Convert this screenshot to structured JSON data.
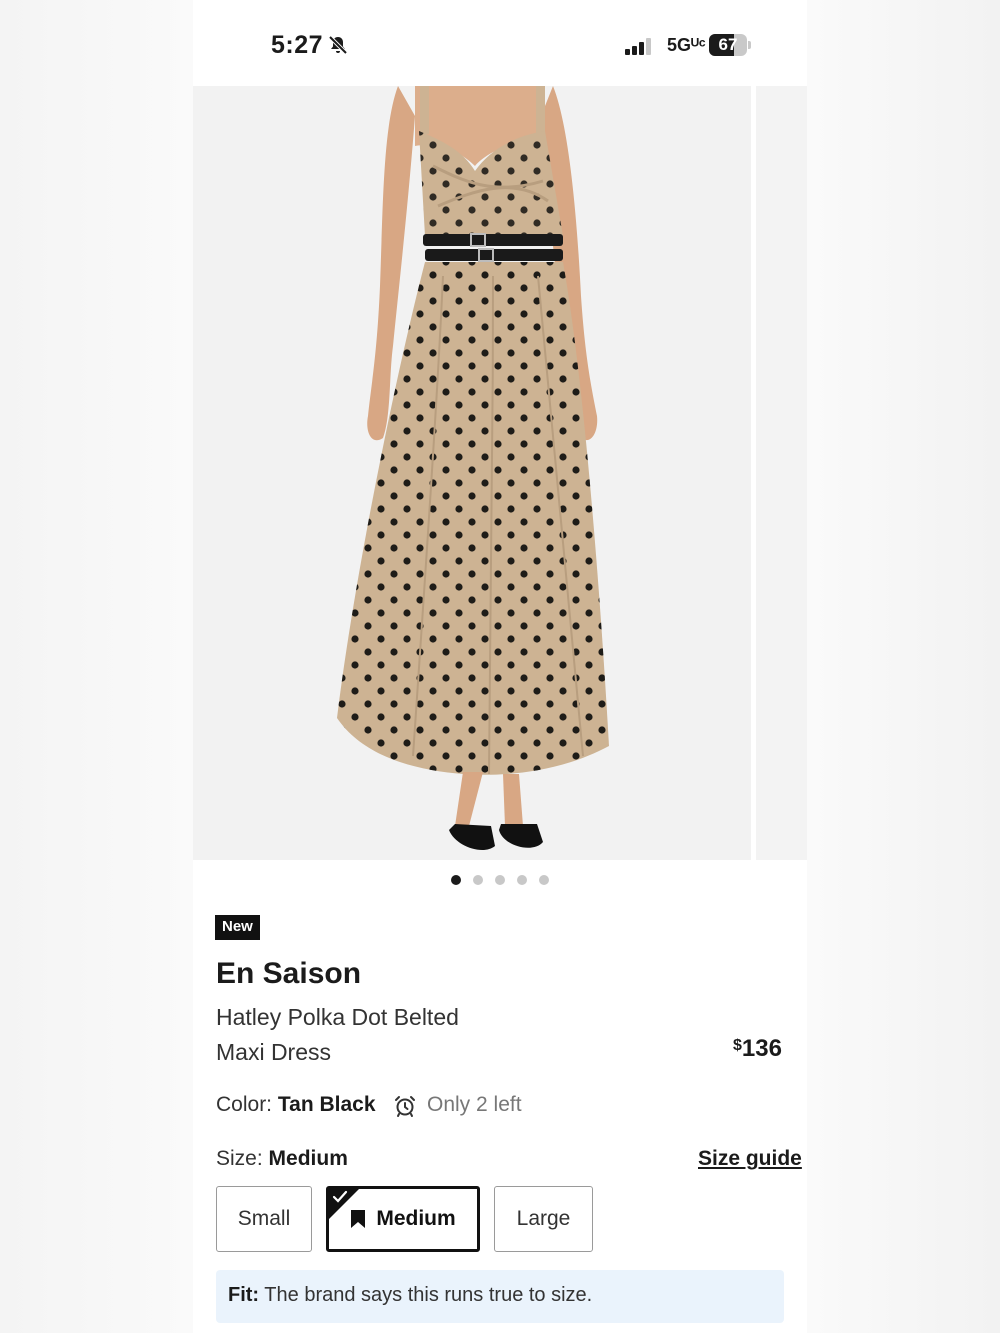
{
  "status_bar": {
    "time": "5:27",
    "network": "5Gᵁᶜ",
    "battery_level": "67",
    "battery_fraction": 0.67,
    "icons": [
      "bell-slash-icon",
      "signal-icon",
      "battery-icon"
    ]
  },
  "carousel": {
    "image_description_icon": "product-photo",
    "dot_count": 5,
    "active_index": 0
  },
  "product": {
    "badge": "New",
    "brand": "En Saison",
    "name_line1": "Hatley Polka Dot Belted",
    "name_line2": "Maxi Dress",
    "price_currency": "$",
    "price_value": "136"
  },
  "color": {
    "label": "Color:",
    "value": "Tan Black",
    "stock": "Only 2 left"
  },
  "size": {
    "label": "Size:",
    "value": "Medium",
    "guide_link": "Size guide",
    "options": [
      "Small",
      "Medium",
      "Large"
    ],
    "selected": "Medium"
  },
  "fit": {
    "label": "Fit:",
    "text": "The brand says this runs true to size."
  },
  "colors": {
    "dress_tan": "#cdb393",
    "dot_black": "#1e1c18",
    "fit_box_bg": "#eaf3fc"
  }
}
